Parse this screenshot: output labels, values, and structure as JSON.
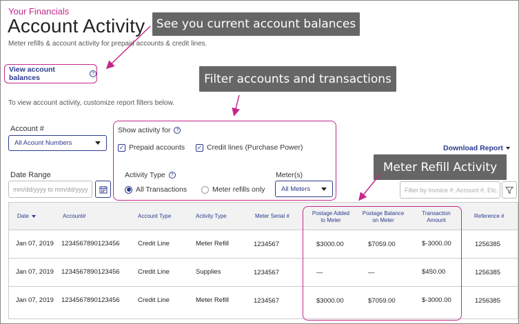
{
  "header": {
    "brand": "Your Financials",
    "title": "Account Activity",
    "subtitle": "Meter refills & account activity for prepaid accounts & credit lines."
  },
  "links": {
    "view_balances": "View account balances",
    "download_report": "Download Report"
  },
  "callouts": {
    "balances": "See you current account balances",
    "filter": "Filter accounts and transactions",
    "refill": "Meter Refill Activity"
  },
  "intro": "To view account activity, customize report filters below.",
  "filters": {
    "account_label": "Account #",
    "account_value": "All Acount Numbers",
    "show_activity_for": "Show activity for",
    "prepaid_label": "Prepaid accounts",
    "credit_label": "Credit lines (Purchase Power)",
    "activity_type_label": "Activity Type",
    "radio_all": "All Transactions",
    "radio_refills": "Meter refills only",
    "meters_label": "Meter(s)",
    "meters_value": "All Meters",
    "date_label": "Date Range",
    "date_placeholder": "mm/dd/yyyy to mm/dd/yyyy",
    "search_placeholder": "Filter by Invoice #, Account #, Etc."
  },
  "table": {
    "headers": {
      "date": "Date",
      "account": "Account#",
      "account_type": "Account Type",
      "activity_type": "Activity Type",
      "meter_serial": "Meter Serial #",
      "postage_added_1": "Postage Added",
      "postage_added_2": "to Meter",
      "postage_balance_1": "Postage Balance",
      "postage_balance_2": "on Meter",
      "amount_1": "Transaction",
      "amount_2": "Amount",
      "reference": "Reference #"
    },
    "rows": [
      {
        "date": "Jan 07, 2019",
        "account": "1234567890123456",
        "type": "Credit Line",
        "activity": "Meter Refill",
        "serial": "1234567",
        "added": "$3000.00",
        "balance": "$7059.00",
        "amount": "$-3000.00",
        "ref": "1256385"
      },
      {
        "date": "Jan 07, 2019",
        "account": "1234567890123456",
        "type": "Credit Line",
        "activity": "Supplies",
        "serial": "1234567",
        "added": "—",
        "balance": "—",
        "amount": "$450.00",
        "ref": "1256385"
      },
      {
        "date": "Jan 07, 2019",
        "account": "1234567890123456",
        "type": "Credit Line",
        "activity": "Meter Refill",
        "serial": "1234567",
        "added": "$3000.00",
        "balance": "$7059.00",
        "amount": "$-3000.00",
        "ref": "1256385"
      }
    ]
  },
  "colors": {
    "accent": "#c4278b",
    "link": "#2b3a8c",
    "callout_bg": "#666666"
  }
}
